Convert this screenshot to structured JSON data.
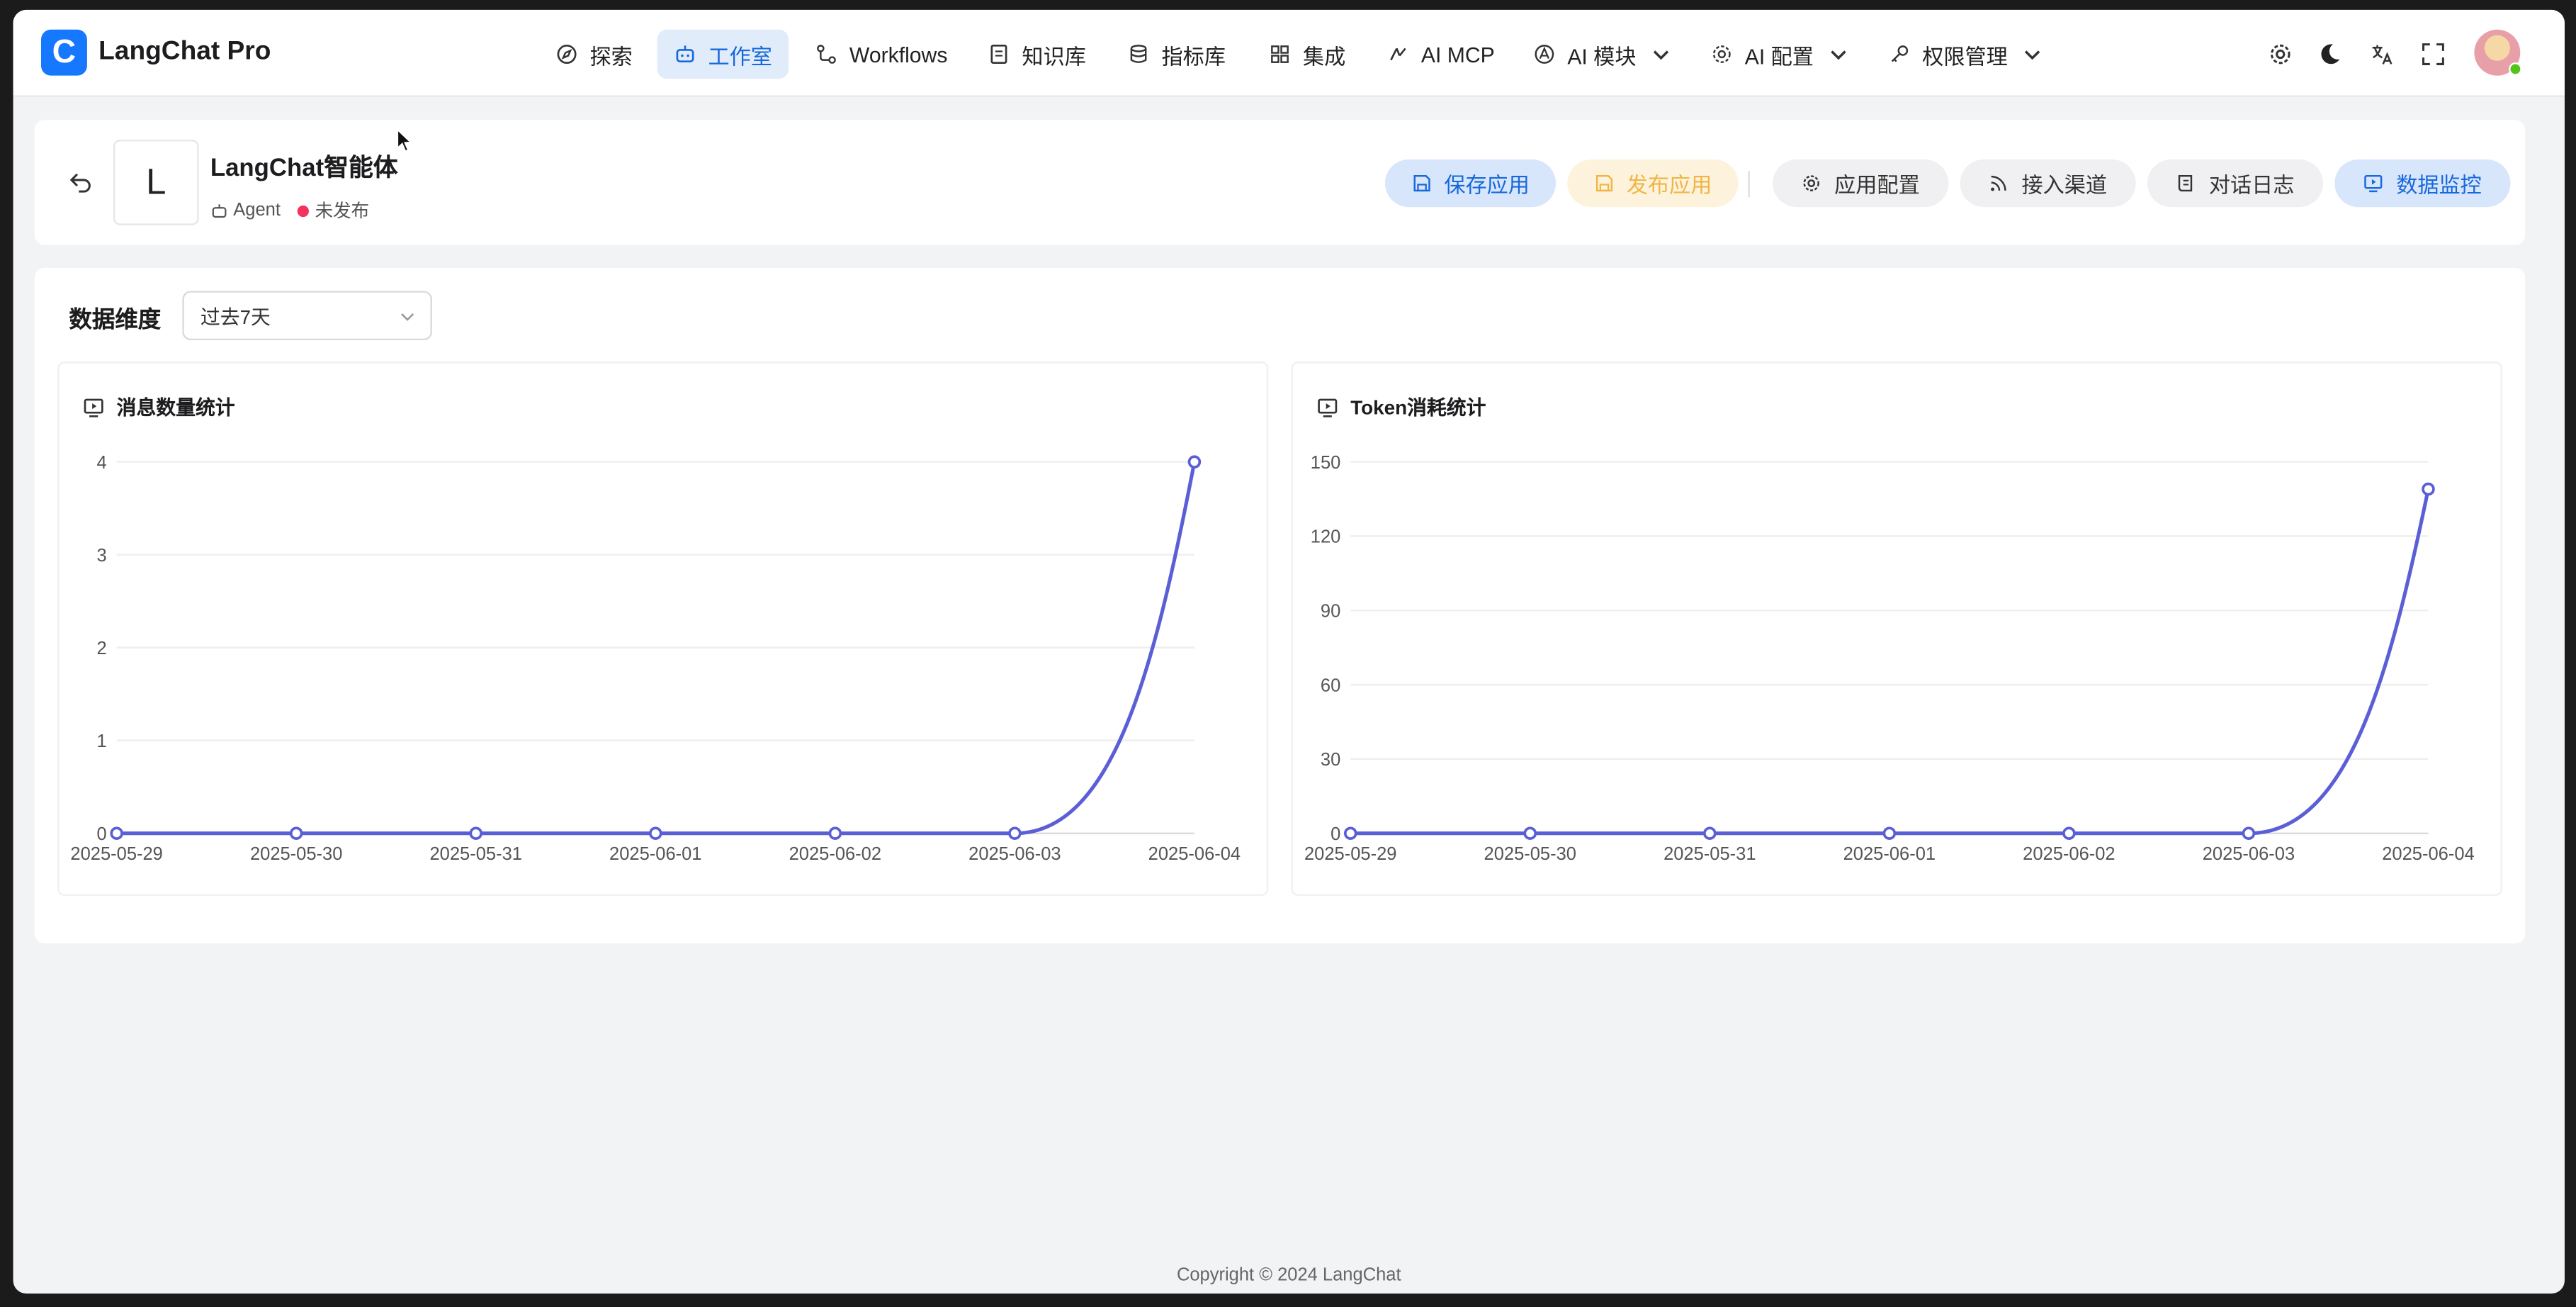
{
  "app": {
    "logo_letter": "C",
    "name": "LangChat Pro"
  },
  "nav": {
    "items": [
      {
        "label": "探索",
        "icon": "compass-icon"
      },
      {
        "label": "工作室",
        "icon": "robot-icon",
        "active": true
      },
      {
        "label": "Workflows",
        "icon": "workflow-icon"
      },
      {
        "label": "知识库",
        "icon": "book-icon"
      },
      {
        "label": "指标库",
        "icon": "database-icon"
      },
      {
        "label": "集成",
        "icon": "grid-icon"
      },
      {
        "label": "AI MCP",
        "icon": "mcp-icon"
      },
      {
        "label": "AI 模块",
        "icon": "module-icon",
        "dropdown": true
      },
      {
        "label": "AI 配置",
        "icon": "gear-icon",
        "dropdown": true
      },
      {
        "label": "权限管理",
        "icon": "key-icon",
        "dropdown": true
      }
    ]
  },
  "header": {
    "avatar_letter": "L",
    "app_name": "LangChat智能体",
    "type_label": "Agent",
    "status_label": "未发布",
    "status_color": "#f5315e",
    "buttons": {
      "save": "保存应用",
      "publish": "发布应用",
      "config": "应用配置",
      "channel": "接入渠道",
      "logs": "对话日志",
      "monitor": "数据监控"
    }
  },
  "filter": {
    "label": "数据维度",
    "selected": "过去7天"
  },
  "charts": {
    "messages_title": "消息数量统计",
    "tokens_title": "Token消耗统计"
  },
  "chart_data": [
    {
      "type": "line",
      "title": "消息数量统计",
      "x": [
        "2025-05-29",
        "2025-05-30",
        "2025-05-31",
        "2025-06-01",
        "2025-06-02",
        "2025-06-03",
        "2025-06-04"
      ],
      "values": [
        0,
        0,
        0,
        0,
        0,
        0,
        4
      ],
      "yticks": [
        0,
        1,
        2,
        3,
        4
      ],
      "ylim": [
        0,
        4
      ],
      "color": "#5b5fd6",
      "grid": true,
      "smooth": true
    },
    {
      "type": "line",
      "title": "Token消耗统计",
      "x": [
        "2025-05-29",
        "2025-05-30",
        "2025-05-31",
        "2025-06-01",
        "2025-06-02",
        "2025-06-03",
        "2025-06-04"
      ],
      "values": [
        0,
        0,
        0,
        0,
        0,
        0,
        139
      ],
      "yticks": [
        0,
        30,
        60,
        90,
        120,
        150
      ],
      "ylim": [
        0,
        150
      ],
      "color": "#5b5fd6",
      "grid": true,
      "smooth": true
    }
  ],
  "footer": {
    "copyright": "Copyright © 2024 LangChat"
  }
}
